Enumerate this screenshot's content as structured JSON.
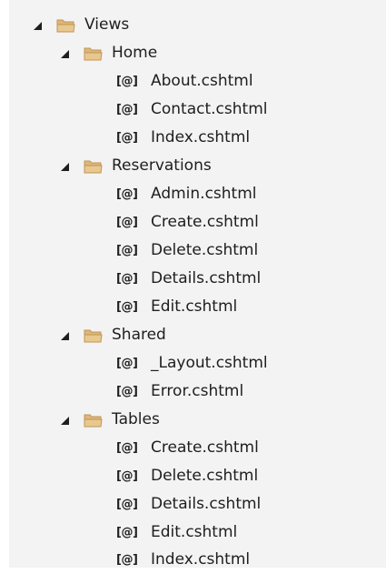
{
  "tree": {
    "root": {
      "label": "Views",
      "icon": "folder-open-icon",
      "expanded": true
    },
    "folders": [
      {
        "label": "Home",
        "expanded": true,
        "files": [
          "About.cshtml",
          "Contact.cshtml",
          "Index.cshtml"
        ]
      },
      {
        "label": "Reservations",
        "expanded": true,
        "files": [
          "Admin.cshtml",
          "Create.cshtml",
          "Delete.cshtml",
          "Details.cshtml",
          "Edit.cshtml"
        ]
      },
      {
        "label": "Shared",
        "expanded": true,
        "files": [
          "_Layout.cshtml",
          "Error.cshtml"
        ]
      },
      {
        "label": "Tables",
        "expanded": true,
        "files": [
          "Create.cshtml",
          "Delete.cshtml",
          "Details.cshtml",
          "Edit.cshtml",
          "Index.cshtml"
        ]
      }
    ],
    "file_icon_glyph": "[@]",
    "file_icon_name": "razor-file-icon",
    "colors": {
      "panel_bg": "#f3f3f3",
      "folder_fill": "#dcb67a",
      "folder_stroke": "#c09553",
      "text": "#1e1e1e"
    }
  }
}
